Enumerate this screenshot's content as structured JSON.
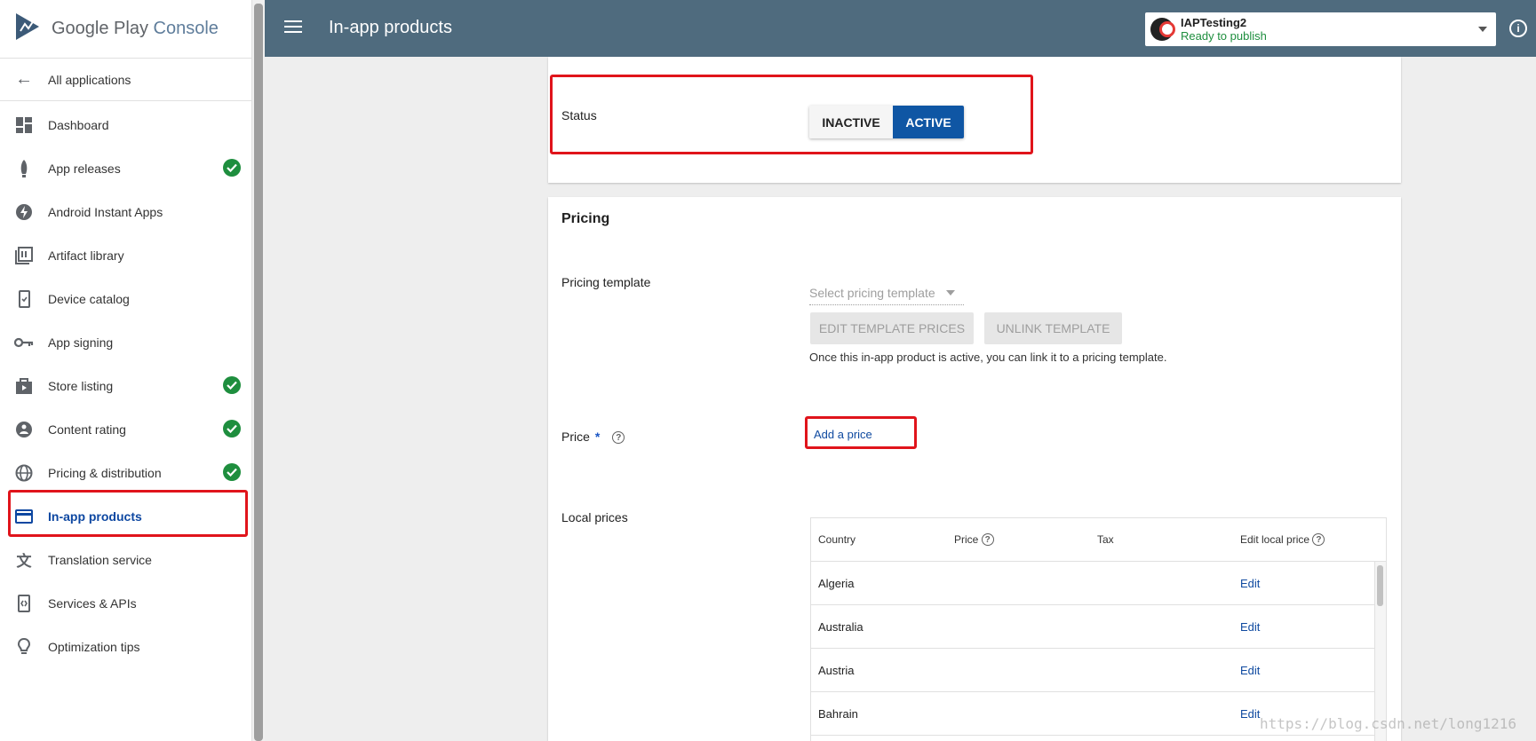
{
  "sidebar": {
    "brand": {
      "google_play": "Google Play",
      "console": "Console"
    },
    "back_label": "All applications",
    "items": [
      {
        "label": "Dashboard",
        "icon": "dashboard-icon",
        "done": false
      },
      {
        "label": "App releases",
        "icon": "rocket-icon",
        "done": true
      },
      {
        "label": "Android Instant Apps",
        "icon": "instant-apps-icon",
        "done": false
      },
      {
        "label": "Artifact library",
        "icon": "library-icon",
        "done": false
      },
      {
        "label": "Device catalog",
        "icon": "device-icon",
        "done": false
      },
      {
        "label": "App signing",
        "icon": "key-icon",
        "done": false
      },
      {
        "label": "Store listing",
        "icon": "store-icon",
        "done": true
      },
      {
        "label": "Content rating",
        "icon": "rating-icon",
        "done": true
      },
      {
        "label": "Pricing & distribution",
        "icon": "globe-icon",
        "done": true
      },
      {
        "label": "In-app products",
        "icon": "credit-card-icon",
        "done": false,
        "active": true
      },
      {
        "label": "Translation service",
        "icon": "translate-icon",
        "done": false
      },
      {
        "label": "Services & APIs",
        "icon": "api-icon",
        "done": false
      },
      {
        "label": "Optimization tips",
        "icon": "lightbulb-icon",
        "done": false
      }
    ]
  },
  "header": {
    "title": "In-app products",
    "app_name": "IAPTesting2",
    "app_status": "Ready to publish"
  },
  "status_card": {
    "label": "Status",
    "inactive_label": "INACTIVE",
    "active_label": "ACTIVE",
    "selected": "ACTIVE"
  },
  "pricing": {
    "title": "Pricing",
    "template_label": "Pricing template",
    "template_placeholder": "Select pricing template",
    "edit_template_btn": "EDIT TEMPLATE PRICES",
    "unlink_template_btn": "UNLINK TEMPLATE",
    "template_hint": "Once this in-app product is active, you can link it to a pricing template.",
    "price_label": "Price",
    "price_required": "*",
    "add_price_link": "Add a price",
    "local_prices_label": "Local prices",
    "table": {
      "headers": [
        "Country",
        "Price",
        "Tax",
        "Edit local price"
      ],
      "rows": [
        {
          "country": "Algeria",
          "price": "",
          "tax": "",
          "action": "Edit"
        },
        {
          "country": "Australia",
          "price": "",
          "tax": "",
          "action": "Edit"
        },
        {
          "country": "Austria",
          "price": "",
          "tax": "",
          "action": "Edit"
        },
        {
          "country": "Bahrain",
          "price": "",
          "tax": "",
          "action": "Edit"
        }
      ]
    }
  },
  "watermark": "https://blog.csdn.net/long1216",
  "colors": {
    "topbar": "#4f6b7e",
    "primary": "#0f56a4",
    "success": "#1e8e3e",
    "highlight": "#e0141b"
  }
}
